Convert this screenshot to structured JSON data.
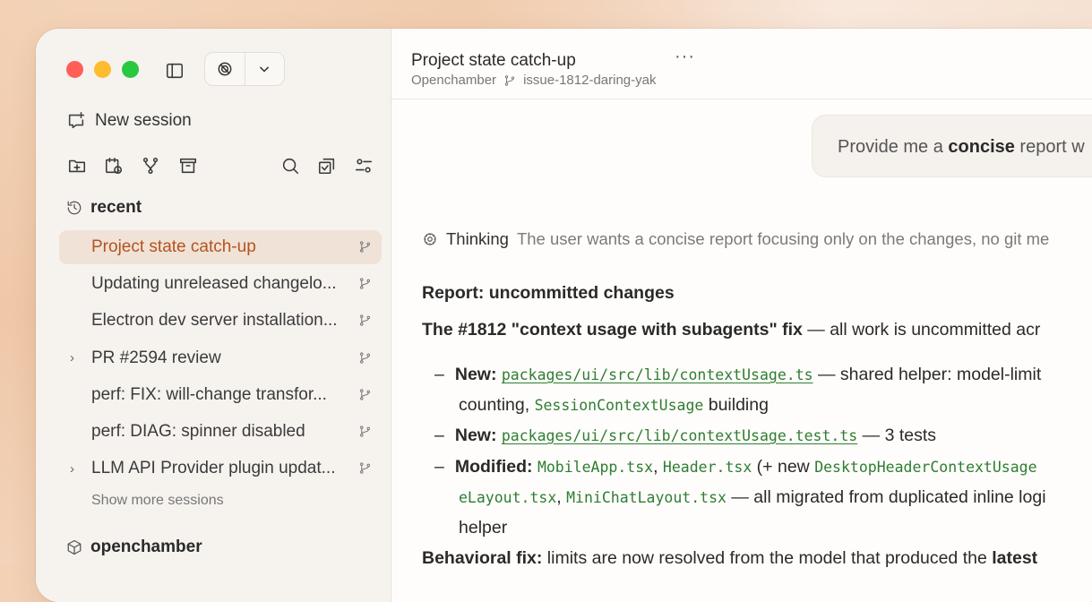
{
  "sidebar": {
    "new_session": "New session",
    "recent_heading": "recent",
    "sessions": [
      {
        "title": "Project state catch-up",
        "active": true,
        "expandable": false
      },
      {
        "title": "Updating unreleased changelo...",
        "active": false,
        "expandable": false
      },
      {
        "title": "Electron dev server installation...",
        "active": false,
        "expandable": false
      },
      {
        "title": "PR #2594 review",
        "active": false,
        "expandable": true
      },
      {
        "title": "perf: FIX: will-change transfor...",
        "active": false,
        "expandable": false
      },
      {
        "title": "perf: DIAG: spinner disabled",
        "active": false,
        "expandable": false
      },
      {
        "title": "LLM API Provider plugin updat...",
        "active": false,
        "expandable": true
      }
    ],
    "show_more": "Show more sessions",
    "project_heading": "openchamber",
    "expand_chevron": "›"
  },
  "header": {
    "title": "Project state catch-up",
    "more": "···",
    "project": "Openchamber",
    "branch": "issue-1812-daring-yak"
  },
  "chat": {
    "user_prefix": "Provide me a ",
    "user_bold": "concise",
    "user_suffix": " report w",
    "thinking_label": "Thinking",
    "thinking_text": "The user wants a concise report focusing only on the changes, no git me",
    "report_heading": "Report: uncommitted changes",
    "fix_title": "The #1812 \"context usage with subagents\" fix",
    "fix_rest": " — all work is uncommitted acr",
    "bullets": {
      "b1_label": "New:",
      "b1_code": "packages/ui/src/lib/contextUsage.ts",
      "b1_text": " — shared helper: model-limit",
      "b1_cont": "counting, ",
      "b1_code2": "SessionContextUsage",
      "b1_cont2": " building",
      "b2_label": "New:",
      "b2_code": "packages/ui/src/lib/contextUsage.test.ts",
      "b2_text": " — 3 tests",
      "b3_label": "Modified:",
      "b3_code1": "MobileApp.tsx",
      "b3_sep1": ", ",
      "b3_code2": "Header.tsx",
      "b3_mid": " (+ new ",
      "b3_code3": "DesktopHeaderContextUsage",
      "b3_code4": "eLayout.tsx",
      "b3_sep2": ", ",
      "b3_code5": "MiniChatLayout.tsx",
      "b3_text": " — all migrated from duplicated inline logi",
      "b3_cont": "helper",
      "dash": "–"
    },
    "behavioral_label": "Behavioral fix:",
    "behavioral_text": " limits are now resolved from the model that produced the ",
    "behavioral_bold": "latest"
  }
}
